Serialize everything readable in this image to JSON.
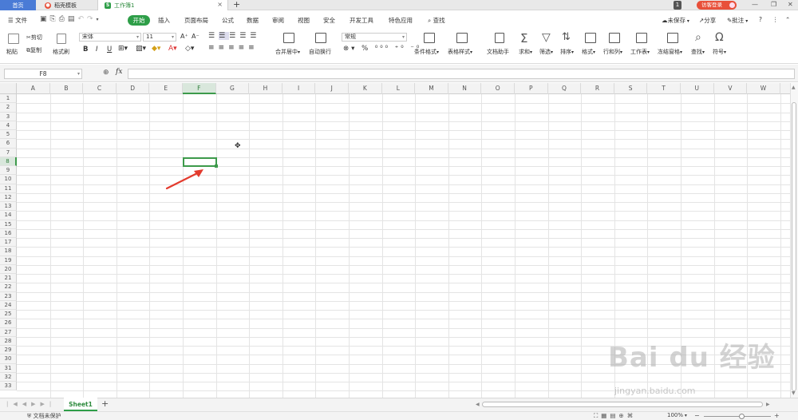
{
  "titlebar": {
    "tabs": [
      {
        "label": "首页"
      },
      {
        "label": "稻壳模板"
      },
      {
        "label": "工作簿1"
      }
    ],
    "window_count": "1",
    "visitor_label": "访客登录",
    "new_tab_label": "+",
    "close_label": "×"
  },
  "menubar": {
    "file_label": "文件",
    "items": [
      "开始",
      "插入",
      "页面布局",
      "公式",
      "数据",
      "审阅",
      "视图",
      "安全",
      "开发工具",
      "特色应用"
    ],
    "search_label": "查找",
    "unsaved_label": "未保存",
    "share_label": "分享",
    "comment_label": "批注"
  },
  "ribbon": {
    "paste_label": "粘贴",
    "cut_label": "剪切",
    "copy_label": "复制",
    "format_painter_label": "格式刷",
    "font_name": "宋体",
    "font_size": "11",
    "bold": "B",
    "italic": "I",
    "underline": "U",
    "merge_label": "合并居中",
    "wrap_label": "自动换行",
    "number_format": "常规",
    "cond_format_label": "条件格式",
    "table_style_label": "表格样式",
    "doc_assistant_label": "文档助手",
    "sum_label": "求和",
    "filter_label": "筛选",
    "sort_label": "排序",
    "format_label": "格式",
    "rowcol_label": "行和列",
    "sheet_label": "工作表",
    "freeze_label": "冻结窗格",
    "find_label": "查找",
    "symbol_label": "符号"
  },
  "formula_bar": {
    "name_box": "F8",
    "fx": "fx",
    "value": ""
  },
  "sheet": {
    "columns": [
      "A",
      "B",
      "C",
      "D",
      "E",
      "F",
      "G",
      "H",
      "I",
      "J",
      "K",
      "L",
      "M",
      "N",
      "O",
      "P",
      "Q",
      "R",
      "S",
      "T",
      "U",
      "V",
      "W"
    ],
    "rows": [
      "1",
      "2",
      "3",
      "4",
      "5",
      "6",
      "7",
      "8",
      "9",
      "10",
      "11",
      "12",
      "13",
      "14",
      "15",
      "16",
      "17",
      "18",
      "19",
      "20",
      "21",
      "22",
      "23",
      "24",
      "25",
      "26",
      "27",
      "28",
      "29",
      "30",
      "31",
      "32",
      "33"
    ],
    "selected_cell": "F8",
    "tab_name": "Sheet1",
    "add_sheet": "+"
  },
  "statusbar": {
    "protect_label": "文档未保护",
    "zoom": "100%"
  },
  "watermark": {
    "logo": "Bai du 经验",
    "url": "jingyan.baidu.com"
  },
  "colors": {
    "accent_green": "#2e9e48",
    "home_tab_blue": "#4a7bd6",
    "visitor_red": "#e8503a",
    "arrow_red": "#e33b2e"
  }
}
